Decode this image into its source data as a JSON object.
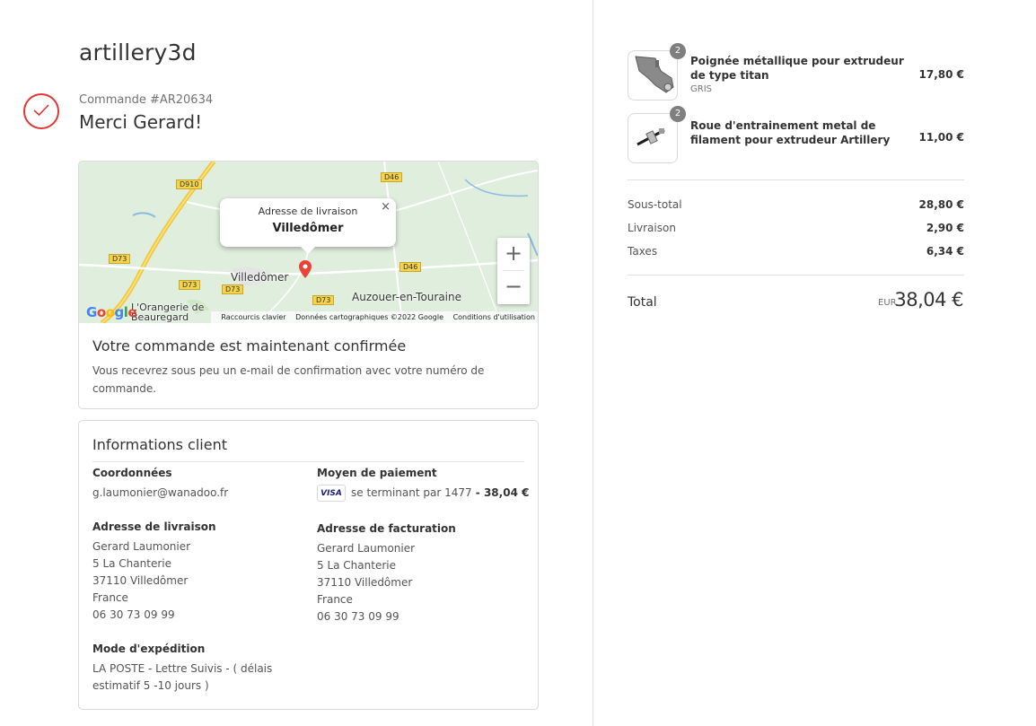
{
  "shop": {
    "name": "artillery3d"
  },
  "order": {
    "number": "Commande #AR20634",
    "thanks": "Merci Gerard!"
  },
  "map": {
    "popup_title": "Adresse de livraison",
    "popup_place": "Villedômer",
    "close": "×",
    "places": {
      "villedomer": "Villedômer",
      "auzouer": "Auzouer-en-Touraine",
      "orangerie": "L'Orangerie de Beauregard"
    },
    "roads": {
      "d910": "D910",
      "d46a": "D46",
      "d46b": "D46",
      "d73a": "D73",
      "d73b": "D73",
      "d73c": "D73",
      "d73d": "D73"
    },
    "zoom_in": "+",
    "zoom_out": "−",
    "footer": {
      "shortcuts": "Raccourcis clavier",
      "data": "Données cartographiques ©2022 Google",
      "terms": "Conditions d'utilisation"
    },
    "logo": "Google"
  },
  "confirmation": {
    "title": "Votre commande est maintenant confirmée",
    "text": "Vous recevrez sous peu un e-mail de confirmation avec votre numéro de commande."
  },
  "customer": {
    "title": "Informations client",
    "contact_label": "Coordonnées",
    "email": "g.laumonier@wanadoo.fr",
    "payment_label": "Moyen de paiement",
    "card_brand": "VISA",
    "payment_text": "se terminant par 1477",
    "payment_amount": " - 38,04 €",
    "shipping_label": "Adresse de livraison",
    "shipping": [
      "Gerard Laumonier",
      "5 La Chanterie",
      "37110 Villedômer",
      "France",
      "06 30 73 09 99"
    ],
    "billing_label": "Adresse de facturation",
    "billing": [
      "Gerard Laumonier",
      "5 La Chanterie",
      "37110 Villedômer",
      "France",
      "06 30 73 09 99"
    ],
    "method_label": "Mode d'expédition",
    "method": "LA POSTE - Lettre Suivis - ( délais estimatif 5 -10 jours )"
  },
  "cart": {
    "items": [
      {
        "qty": "2",
        "name": "Poignée métallique pour extrudeur de type titan",
        "variant": "GRIS",
        "price": "17,80 €"
      },
      {
        "qty": "2",
        "name": "Roue d'entrainement metal de filament pour extrudeur Artillery",
        "variant": "",
        "price": "11,00 €"
      }
    ],
    "subtotal_label": "Sous-total",
    "subtotal": "28,80 €",
    "shipping_label": "Livraison",
    "shipping": "2,90 €",
    "taxes_label": "Taxes",
    "taxes": "6,34 €",
    "total_label": "Total",
    "currency": "EUR",
    "total": "38,04 €"
  },
  "colors": {
    "accent": "#e23535",
    "map_bg": "#dfeedd",
    "road": "#f6d44a"
  }
}
